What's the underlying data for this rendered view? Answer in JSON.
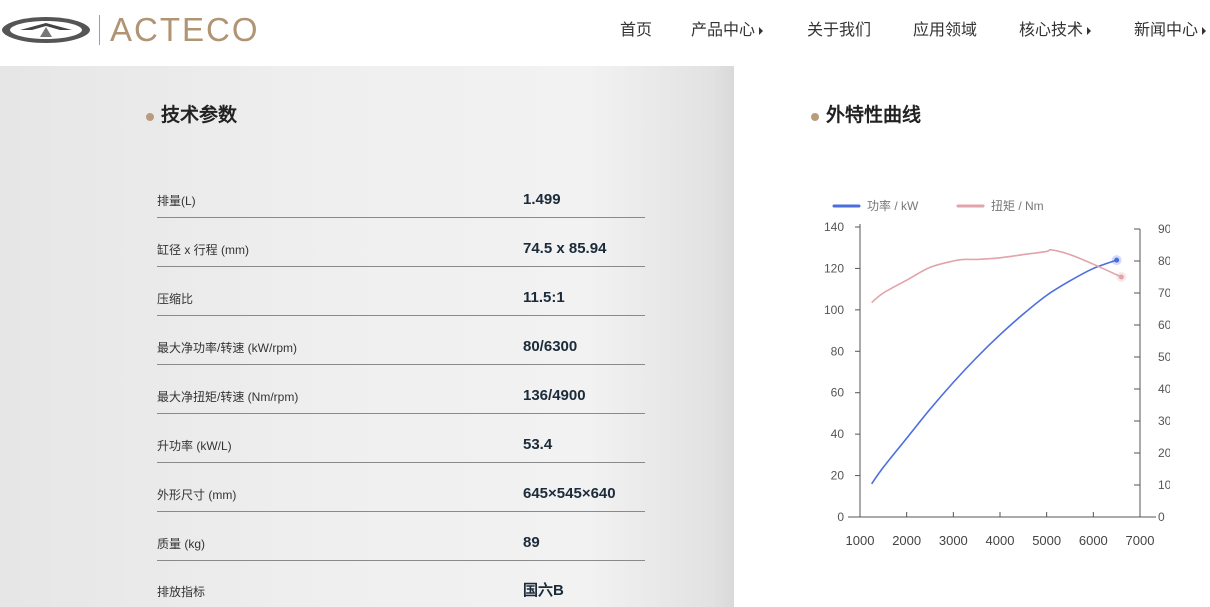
{
  "header": {
    "logo_text": "ACTECO",
    "nav": [
      {
        "label": "首页",
        "has_arrow": false
      },
      {
        "label": "产品中心",
        "has_arrow": true
      },
      {
        "label": "关于我们",
        "has_arrow": false
      },
      {
        "label": "应用领域",
        "has_arrow": false
      },
      {
        "label": "核心技术",
        "has_arrow": true
      },
      {
        "label": "新闻中心",
        "has_arrow": true
      }
    ]
  },
  "specs": {
    "title": "技术参数",
    "rows": [
      {
        "label": "排量(L)",
        "value": "1.499"
      },
      {
        "label": "缸径 x 行程 (mm)",
        "value": "74.5 x 85.94"
      },
      {
        "label": "压缩比",
        "value": "11.5:1"
      },
      {
        "label": "最大净功率/转速 (kW/rpm)",
        "value": "80/6300"
      },
      {
        "label": "最大净扭矩/转速 (Nm/rpm)",
        "value": "136/4900"
      },
      {
        "label": "升功率 (kW/L)",
        "value": "53.4"
      },
      {
        "label": "外形尺寸 (mm)",
        "value": "645×545×640"
      },
      {
        "label": "质量 (kg)",
        "value": "89"
      },
      {
        "label": "排放指标",
        "value": "国六B"
      }
    ]
  },
  "curve": {
    "title": "外特性曲线"
  },
  "colors": {
    "accent": "#b89c7c",
    "power_line": "#4a6ee0",
    "torque_line": "#e2a3aa"
  },
  "chart_data": {
    "type": "line",
    "x": [
      1250,
      1500,
      2000,
      2500,
      3000,
      3250,
      3500,
      4000,
      4500,
      5000,
      5100,
      5500,
      6000,
      6500,
      6600
    ],
    "xlim": [
      1000,
      7000
    ],
    "xticks": [
      "1000",
      "2000",
      "3000",
      "4000",
      "5000",
      "6000",
      "7000"
    ],
    "y_left_ticks": [
      "0",
      "20",
      "40",
      "60",
      "80",
      "100",
      "120",
      "140"
    ],
    "y_left_lim": [
      0,
      140
    ],
    "y_right_ticks": [
      "0",
      "10",
      "20",
      "30",
      "40",
      "50",
      "60",
      "70",
      "80",
      "90"
    ],
    "y_right_lim": [
      0,
      90
    ],
    "series": [
      {
        "name": "功率 / kW",
        "axis": "left",
        "x": [
          1250,
          1500,
          2000,
          2500,
          3000,
          3500,
          4000,
          4500,
          5000,
          5500,
          6000,
          6500
        ],
        "values": [
          16,
          24,
          38,
          52,
          65,
          77,
          88,
          98,
          107,
          114,
          120,
          124
        ]
      },
      {
        "name": "扭矩 / Nm",
        "axis": "right",
        "x": [
          1250,
          1500,
          2000,
          2500,
          3000,
          3250,
          3500,
          4000,
          4500,
          5000,
          5100,
          5500,
          6000,
          6600
        ],
        "values": [
          67,
          70,
          74,
          78,
          80,
          80.5,
          80.5,
          81,
          82,
          83,
          83.5,
          82,
          79,
          75
        ]
      }
    ],
    "legend": "top-left",
    "grid": false
  }
}
